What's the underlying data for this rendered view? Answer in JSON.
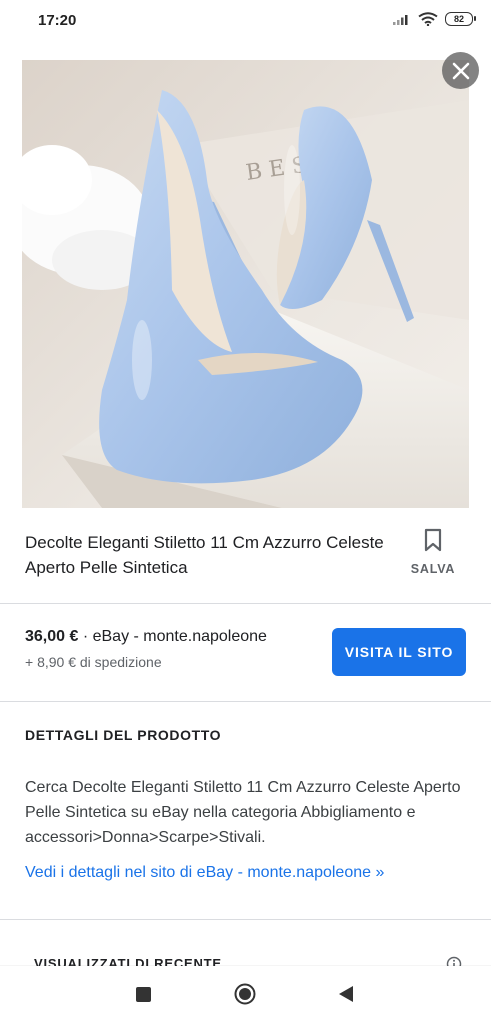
{
  "status_bar": {
    "time": "17:20",
    "battery": "82"
  },
  "product": {
    "image_alt": "Scarpe decolté azzurre con tacco a spillo",
    "title": "Decolte Eleganti Stiletto 11 Cm Azzurro Celeste Aperto Pelle Sintetica",
    "save_label": "SALVA"
  },
  "offer": {
    "price": "36,00 €",
    "separator": " · ",
    "seller": "eBay - monte.napoleone",
    "shipping": "+ 8,90 € di spedizione",
    "visit_label": "VISITA IL SITO"
  },
  "details": {
    "heading": "DETTAGLI DEL PRODOTTO",
    "description": "Cerca Decolte Eleganti Stiletto 11 Cm Azzurro Celeste Aperto Pelle Sintetica su eBay nella categoria Abbigliamento e accessori>Donna>Scarpe>Stivali.",
    "link": "Vedi i dettagli nel sito di eBay - monte.napoleone »"
  },
  "recent": {
    "heading": "VISUALIZZATI DI RECENTE"
  },
  "colors": {
    "accent": "#1a73e8",
    "shoe": "#a9c4ea"
  },
  "icons": [
    "signal-icon",
    "wifi-icon",
    "battery-icon",
    "close-icon",
    "bookmark-icon",
    "info-icon",
    "nav-recents-icon",
    "nav-home-icon",
    "nav-back-icon"
  ]
}
